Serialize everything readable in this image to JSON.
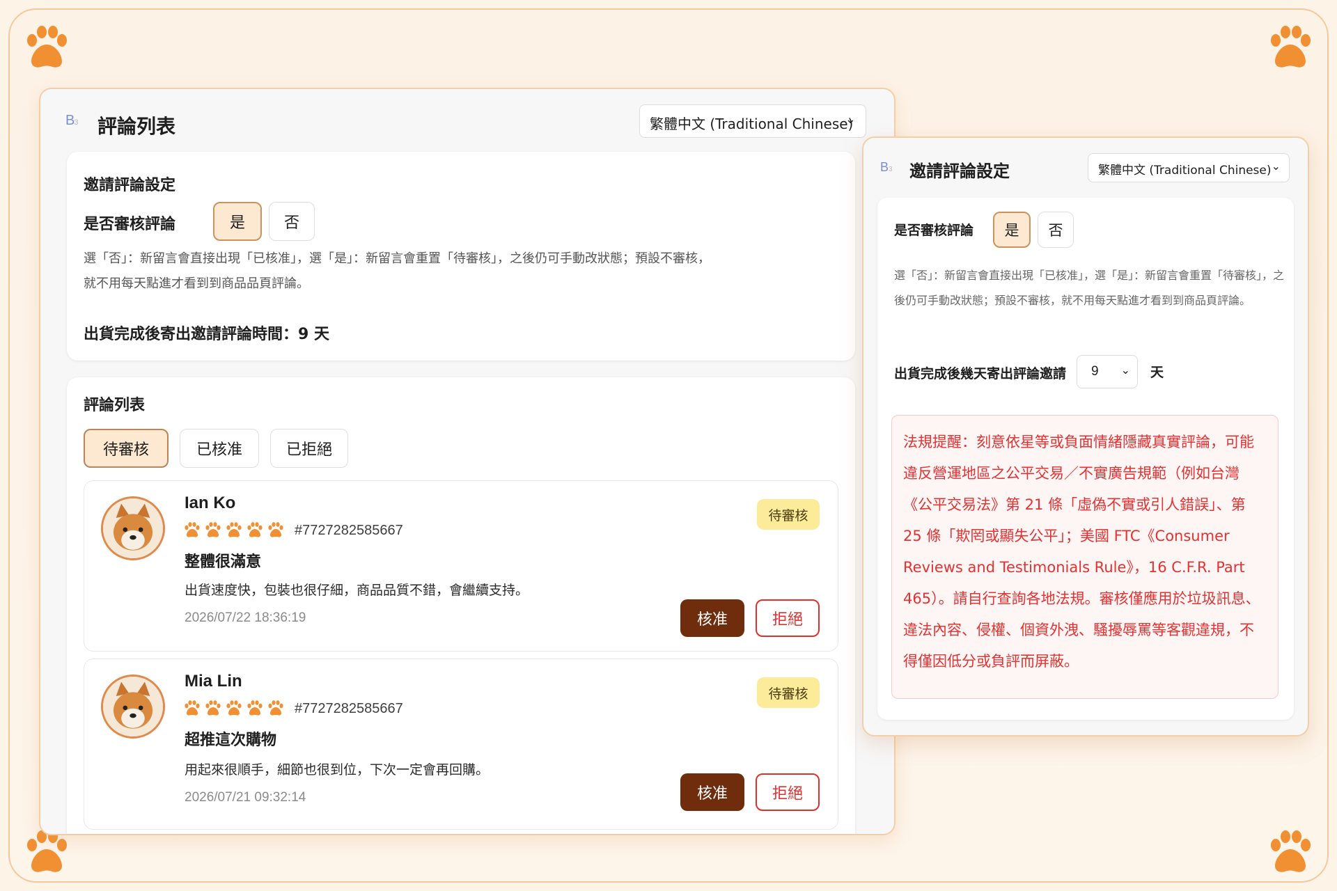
{
  "colors": {
    "accent": "#6f2d0e",
    "danger": "#e0302e",
    "paw": "#f19032",
    "badge": "#fcec9a",
    "selected": "#fde9d2"
  },
  "left_panel": {
    "brand": "B",
    "brand_sub": "3",
    "title": "評論列表",
    "language": "繁體中文 (Traditional Chinese)",
    "settings": {
      "title": "邀請評論設定",
      "review_label": "是否審核評論",
      "yes": "是",
      "no": "否",
      "selected": "yes",
      "desc_line1": "選「否」：新留言會直接出現「已核准」，選「是」：新留言會重置「待審核」，之後仍可手動改狀態；預設不審核，",
      "desc_line2": "就不用每天點進才看到到商品品頁評論。",
      "days_text": "出貨完成後寄出邀請評論時間：9 天"
    },
    "reviews": {
      "title": "評論列表",
      "tabs": [
        "待審核",
        "已核准",
        "已拒絕"
      ],
      "active_tab": "待審核",
      "items": [
        {
          "name": "Ian Ko",
          "rating": 5,
          "order_id": "#7727282585667",
          "title": "整體很滿意",
          "body": "出貨速度快，包裝也很仔細，商品品質不錯，會繼續支持。",
          "date": "2026/07/22 18:36:19",
          "status": "待審核",
          "approve": "核准",
          "reject": "拒絕"
        },
        {
          "name": "Mia Lin",
          "rating": 5,
          "order_id": "#7727282585667",
          "title": "超推這次購物",
          "body": "用起來很順手，細節也很到位，下次一定會再回購。",
          "date": "2026/07/21 09:32:14",
          "status": "待審核",
          "approve": "核准",
          "reject": "拒絕"
        }
      ]
    }
  },
  "right_panel": {
    "brand": "B",
    "brand_sub": "3",
    "title": "邀請評論設定",
    "language": "繁體中文 (Traditional Chinese)",
    "review_label": "是否審核評論",
    "yes": "是",
    "no": "否",
    "selected": "yes",
    "desc": "選「否」：新留言會直接出現「已核准」，選「是」：新留言會重置「待審核」，之後仍可手動改狀態；預設不審核，就不用每天點進才看到到商品頁評論。",
    "days_label": "出貨完成後幾天寄出評論邀請",
    "days_value": "9",
    "days_unit": "天",
    "legal": "法規提醒：刻意依星等或負面情緒隱藏真實評論，可能違反營運地區之公平交易／不實廣告規範（例如台灣《公平交易法》第 21 條「虛偽不實或引人錯誤」、第 25 條「欺罔或顯失公平」；美國 FTC《Consumer Reviews and Testimonials Rule》，16 C.F.R. Part 465）。請自行查詢各地法規。審核僅應用於垃圾訊息、違法內容、侵權、個資外洩、騷擾辱罵等客觀違規，不得僅因低分或負評而屏蔽。"
  },
  "icons": {
    "decor": "paw-icon",
    "rating": "paw-star-icon",
    "avatar": "shiba-avatar",
    "dropdown": "chevron-down-icon"
  }
}
